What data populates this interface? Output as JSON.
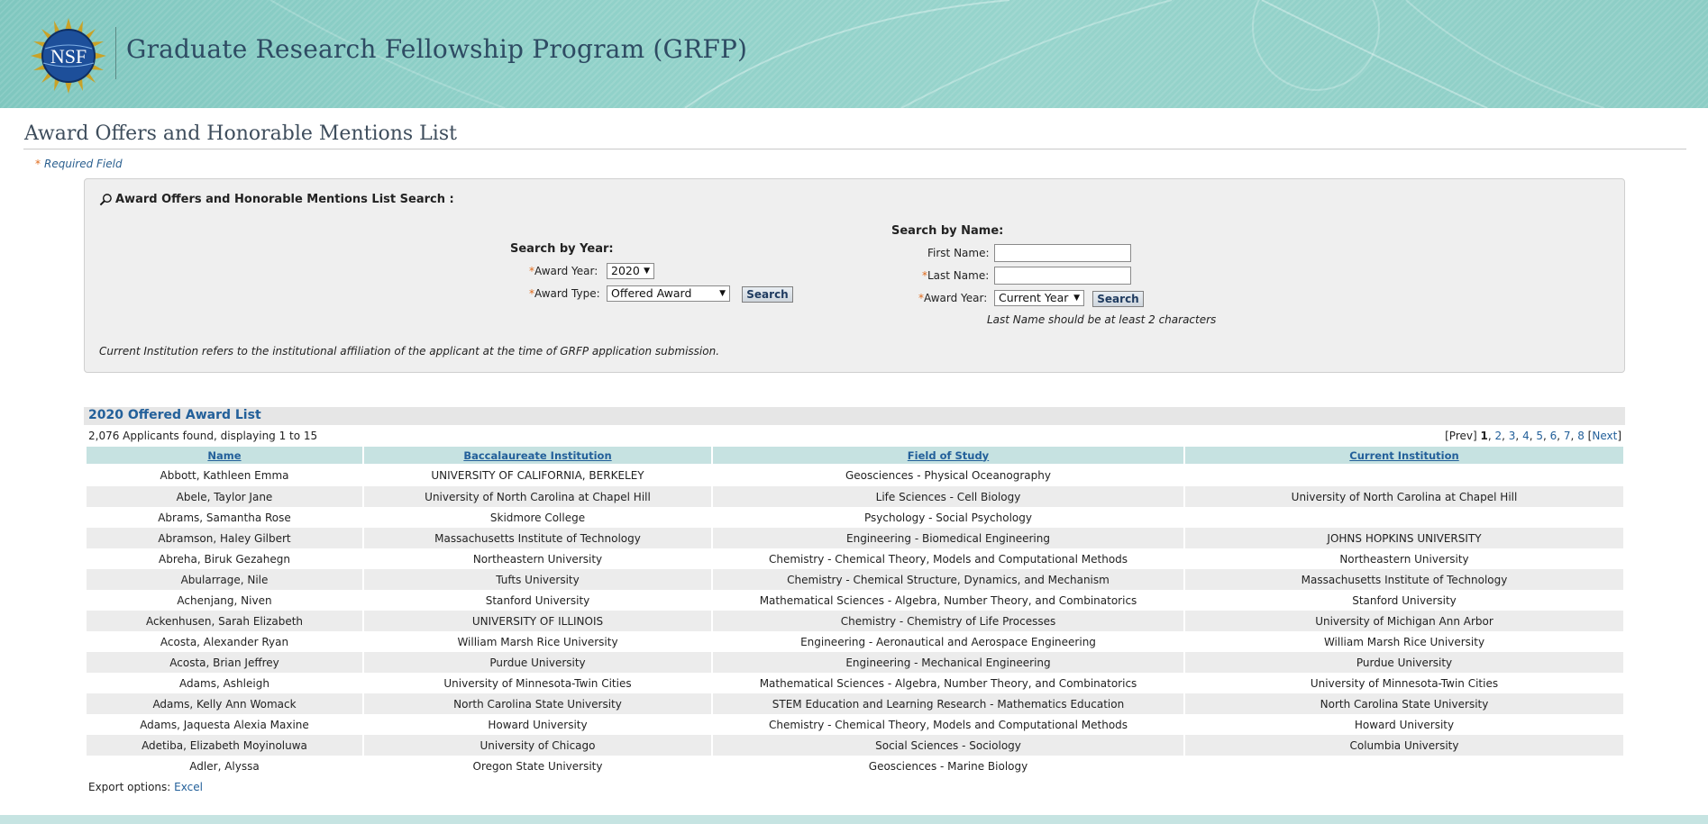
{
  "banner": {
    "logo_text": "NSF",
    "title": "Graduate Research Fellowship Program (GRFP)"
  },
  "page": {
    "title": "Award Offers and Honorable Mentions List",
    "required_star": "*",
    "required_note": "Required Field"
  },
  "search": {
    "heading": "Award Offers and Honorable Mentions List Search :",
    "by_year": {
      "heading": "Search by Year:",
      "award_year_label": "Award Year:",
      "award_year_value": "2020",
      "award_type_label": "Award Type:",
      "award_type_value": "Offered Award",
      "button": "Search"
    },
    "by_name": {
      "heading": "Search by Name:",
      "first_name_label": "First Name:",
      "last_name_label": "Last Name:",
      "award_year_label": "Award Year:",
      "award_year_value": "Current Year",
      "button": "Search",
      "hint": "Last Name should be at least 2 characters"
    },
    "note": "Current Institution refers to the institutional affiliation of the applicant at the time of GRFP application submission."
  },
  "results": {
    "title": "2020 Offered Award List",
    "summary": "2,076 Applicants found, displaying 1 to 15",
    "pager": {
      "prev": "[Prev]",
      "current": "1",
      "pages": [
        "2",
        "3",
        "4",
        "5",
        "6",
        "7",
        "8"
      ],
      "next": "Next",
      "open_bracket": "[",
      "close_bracket": "]"
    },
    "columns": [
      "Name",
      "Baccalaureate Institution",
      "Field of Study",
      "Current Institution"
    ],
    "rows": [
      [
        "Abbott, Kathleen Emma",
        "UNIVERSITY OF CALIFORNIA, BERKELEY",
        "Geosciences - Physical Oceanography",
        ""
      ],
      [
        "Abele, Taylor Jane",
        "University of North Carolina at Chapel Hill",
        "Life Sciences - Cell Biology",
        "University of North Carolina at Chapel Hill"
      ],
      [
        "Abrams, Samantha Rose",
        "Skidmore College",
        "Psychology - Social Psychology",
        ""
      ],
      [
        "Abramson, Haley Gilbert",
        "Massachusetts Institute of Technology",
        "Engineering - Biomedical Engineering",
        "JOHNS HOPKINS UNIVERSITY"
      ],
      [
        "Abreha, Biruk Gezahegn",
        "Northeastern University",
        "Chemistry - Chemical Theory, Models and Computational Methods",
        "Northeastern University"
      ],
      [
        "Abularrage, Nile",
        "Tufts University",
        "Chemistry - Chemical Structure, Dynamics, and Mechanism",
        "Massachusetts Institute of Technology"
      ],
      [
        "Achenjang, Niven",
        "Stanford University",
        "Mathematical Sciences - Algebra, Number Theory, and Combinatorics",
        "Stanford University"
      ],
      [
        "Ackenhusen, Sarah Elizabeth",
        "UNIVERSITY OF ILLINOIS",
        "Chemistry - Chemistry of Life Processes",
        "University of Michigan Ann Arbor"
      ],
      [
        "Acosta, Alexander Ryan",
        "William Marsh Rice University",
        "Engineering - Aeronautical and Aerospace Engineering",
        "William Marsh Rice University"
      ],
      [
        "Acosta, Brian Jeffrey",
        "Purdue University",
        "Engineering - Mechanical Engineering",
        "Purdue University"
      ],
      [
        "Adams, Ashleigh",
        "University of Minnesota-Twin Cities",
        "Mathematical Sciences - Algebra, Number Theory, and Combinatorics",
        "University of Minnesota-Twin Cities"
      ],
      [
        "Adams, Kelly Ann Womack",
        "North Carolina State University",
        "STEM Education and Learning Research - Mathematics Education",
        "North Carolina State University"
      ],
      [
        "Adams, Jaquesta Alexia Maxine",
        "Howard University",
        "Chemistry - Chemical Theory, Models and Computational Methods",
        "Howard University"
      ],
      [
        "Adetiba, Elizabeth Moyinoluwa",
        "University of Chicago",
        "Social Sciences - Sociology",
        "Columbia University"
      ],
      [
        "Adler, Alyssa",
        "Oregon State University",
        "Geosciences - Marine Biology",
        ""
      ]
    ],
    "export_label": "Export options:",
    "export_link": "Excel"
  },
  "colors": {
    "banner": "#8fd0c8",
    "link": "#23609a",
    "header_bg": "#c6e2e1",
    "required": "#e06a1b"
  }
}
